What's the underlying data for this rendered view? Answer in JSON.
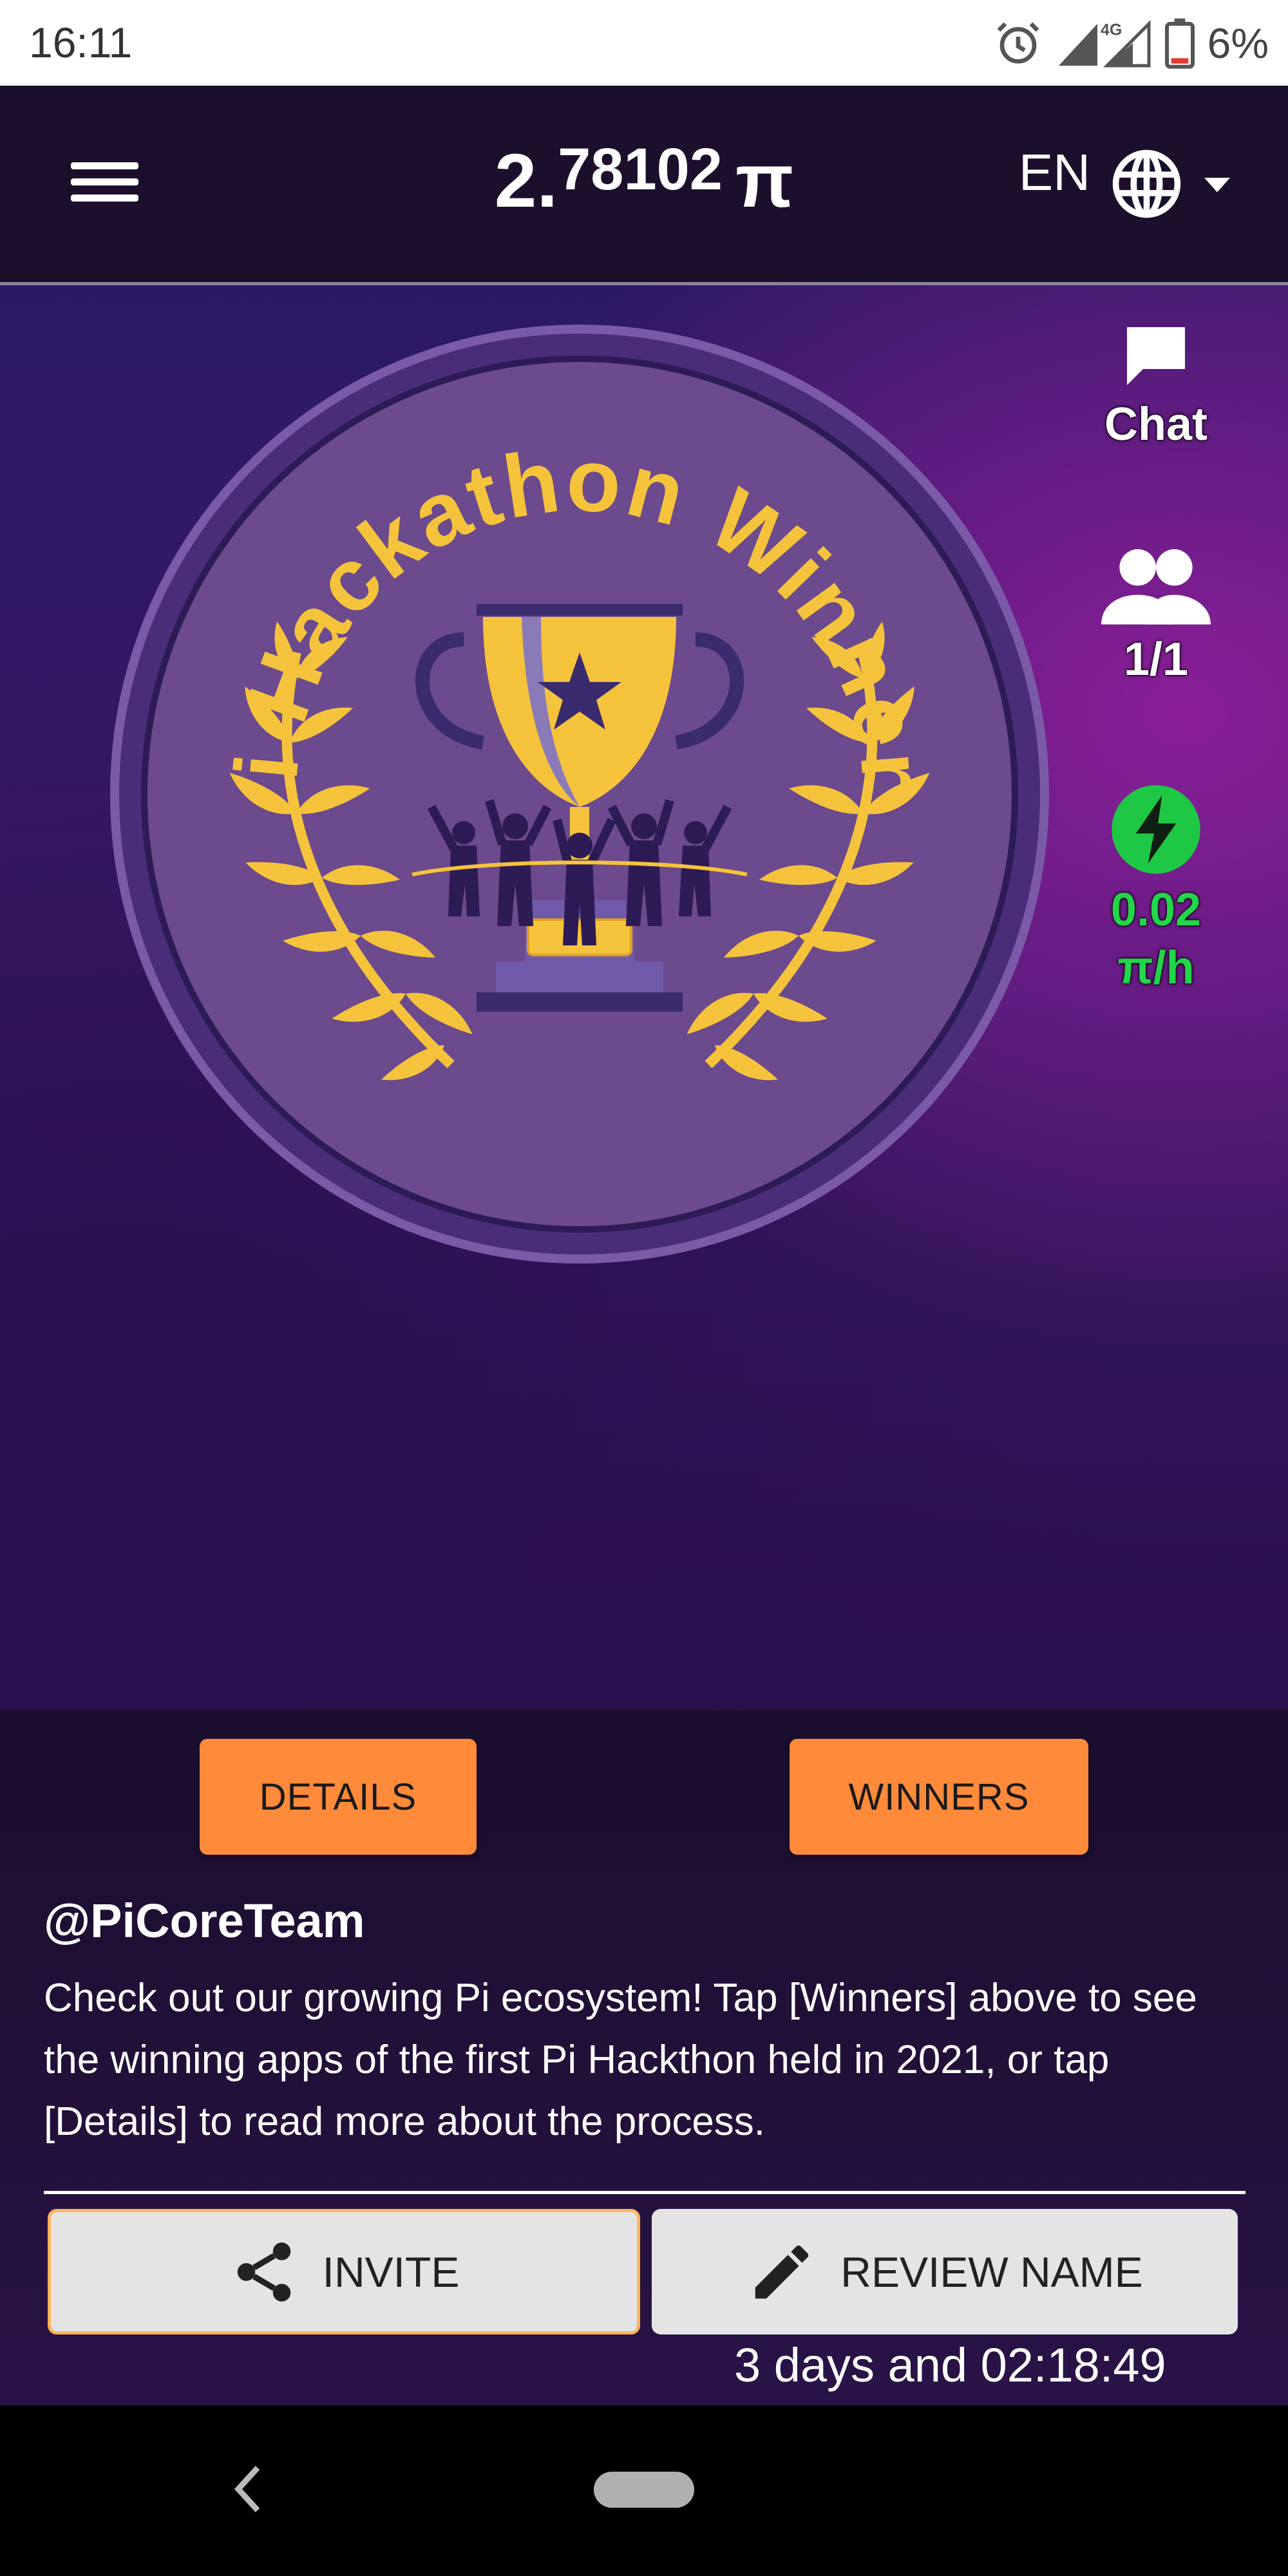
{
  "status_bar": {
    "time": "16:11",
    "network": "4G",
    "battery_percent": "6%"
  },
  "header": {
    "balance_whole": "2.",
    "balance_fraction": "78102",
    "currency_symbol": "π",
    "language": "EN"
  },
  "badge": {
    "title": "Pi Hackathon Winners"
  },
  "side": {
    "chat_label": "Chat",
    "team_count": "1/1",
    "mining_rate": "0.02",
    "mining_unit": "π/h"
  },
  "buttons": {
    "details": "DETAILS",
    "winners": "WINNERS",
    "invite": "INVITE",
    "review_name": "REVIEW NAME"
  },
  "announcement": {
    "author": "@PiCoreTeam",
    "message": "Check out our growing Pi ecosystem! Tap [Winners] above to see the winning apps of the first Pi Hackthon held in 2021, or tap [Details] to read more about the process."
  },
  "countdown": "3 days and 02:18:49",
  "colors": {
    "accent_orange": "#ff8a3a",
    "mining_green": "#22d64a",
    "badge_gold": "#f5c33b",
    "badge_purple": "#6a4a8a"
  }
}
